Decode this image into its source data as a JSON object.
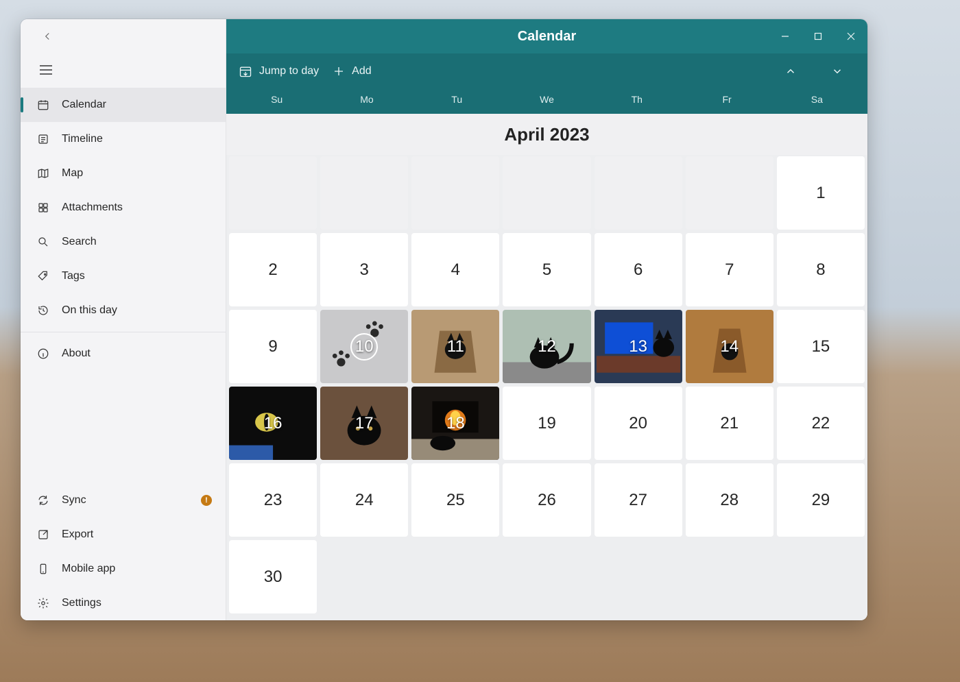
{
  "window": {
    "title": "Calendar"
  },
  "sidebar": {
    "items": [
      {
        "id": "calendar",
        "label": "Calendar",
        "active": true
      },
      {
        "id": "timeline",
        "label": "Timeline",
        "active": false
      },
      {
        "id": "map",
        "label": "Map",
        "active": false
      },
      {
        "id": "attachments",
        "label": "Attachments",
        "active": false
      },
      {
        "id": "search",
        "label": "Search",
        "active": false
      },
      {
        "id": "tags",
        "label": "Tags",
        "active": false
      },
      {
        "id": "onthisday",
        "label": "On this day",
        "active": false
      }
    ],
    "about_label": "About",
    "bottom": [
      {
        "id": "sync",
        "label": "Sync",
        "badge": "!"
      },
      {
        "id": "export",
        "label": "Export",
        "badge": null
      },
      {
        "id": "mobile",
        "label": "Mobile app",
        "badge": null
      },
      {
        "id": "settings",
        "label": "Settings",
        "badge": null
      }
    ]
  },
  "toolbar": {
    "jump_label": "Jump to day",
    "add_label": "Add"
  },
  "weekdays": [
    "Su",
    "Mo",
    "Tu",
    "We",
    "Th",
    "Fr",
    "Sa"
  ],
  "month_title": "April 2023",
  "calendar": {
    "leading_blanks": 6,
    "days": 30,
    "today": 10,
    "photo_days": [
      10,
      11,
      12,
      13,
      14,
      16,
      17,
      18
    ],
    "photo_hints": {
      "10": "paw-prints-grey",
      "11": "cat-in-paper-bag",
      "12": "black-cat-on-porch",
      "13": "cat-at-desk-monitor",
      "14": "cat-in-brown-bag",
      "16": "black-cat-eye-closeup",
      "17": "black-cat-indoor",
      "18": "cat-by-fireplace"
    }
  },
  "colors": {
    "accent": "#1e7b81",
    "accent_dark": "#1a6e74",
    "sidebar_bg": "#f4f4f6",
    "badge": "#c57a14"
  }
}
